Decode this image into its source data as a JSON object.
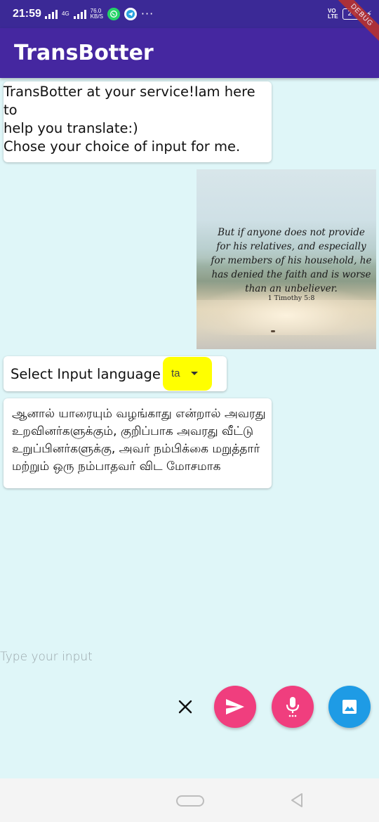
{
  "status_bar": {
    "time": "21:59",
    "net_small_top": "4G",
    "speed_value": "76.0",
    "speed_unit": "KB/S",
    "more_icons": "···",
    "volte_top": "VO",
    "volte_bottom": "LTE",
    "battery_level": "24",
    "debug_label": "DEBUG"
  },
  "app_bar": {
    "title": "TransBotter"
  },
  "messages": {
    "welcome": "TransBotter at your service!Iam here to\nhelp you translate:)\nChose your choice of input for me.",
    "image_quote": {
      "text": "But if anyone does not provide for his relatives, and especially for members of his household, he has denied the faith and is worse than an unbeliever.",
      "reference": "1 Timothy 5:8"
    },
    "language_prompt": "Select Input language",
    "language_selected": "ta",
    "translation": "ஆனால் யாரையும் வழங்காது என்றால் அவரது உறவினர்களுக்கும், குறிப்பாக அவரது வீட்டு உறுப்பினர்களுக்கு, அவர் நம்பிக்கை மறுத்தார் மற்றும் ஒரு நம்பாதவர் விட மோசமாக"
  },
  "input": {
    "placeholder": "Type your input",
    "value": ""
  },
  "actions": {
    "clear_icon": "close-icon",
    "send_icon": "send-icon",
    "mic_icon": "mic-icon",
    "image_icon": "image-icon"
  },
  "colors": {
    "app_bar": "#4527a0",
    "status_bar": "#3b2996",
    "background": "#dff6f8",
    "accent_pink": "#f03e7e",
    "accent_blue": "#1e9be5",
    "language_highlight": "#ffff00"
  }
}
